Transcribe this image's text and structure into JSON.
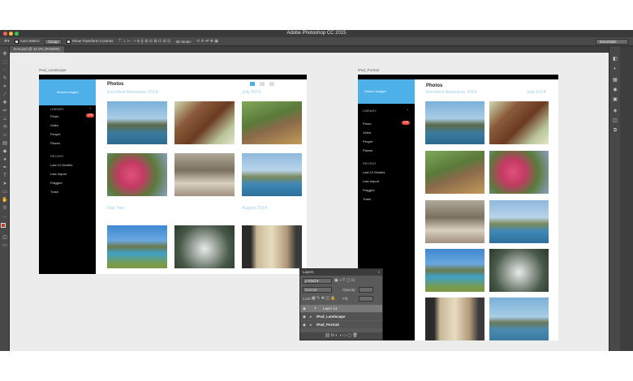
{
  "window": {
    "title": "Adobe Photoshop CC 2015"
  },
  "options_bar": {
    "auto_select_label": "Auto-Select:",
    "auto_select_value": "Group",
    "show_transform_label": "Show Transform Controls",
    "mode_3d": "3D Mode:",
    "workspace": "Essentials"
  },
  "document_tab": {
    "label": "EAV.psd @ 42.3% (RGB/8#)"
  },
  "artboards": {
    "landscape": {
      "label": "iPad_Landscape",
      "search": "Search images",
      "library": "LIBRARY",
      "nav": [
        "Photo",
        "Video",
        "People",
        "Places"
      ],
      "badge": "176",
      "recent": "RECENT",
      "recent_items": [
        "Last 12 Months",
        "Last Import",
        "Flagged",
        "Trash"
      ],
      "title": "Photos",
      "section1": "Excellent Adventure 2014",
      "section1_date": "July 2014",
      "section2": "Day Two",
      "section2_date": "August 2014"
    },
    "portrait": {
      "label": "iPad_Portrait",
      "search": "Search images",
      "library": "LIBRARY",
      "nav": [
        "Photo",
        "Video",
        "People",
        "Places"
      ],
      "badge": "176",
      "recent": "RECENT",
      "recent_items": [
        "Last 12 Months",
        "Last Import",
        "Flagged",
        "Trash"
      ],
      "title": "Photos",
      "section1": "Excellent Adventure 2014",
      "section1_date": "July 2014"
    }
  },
  "layers_panel": {
    "title": "Layers",
    "filter": "Kind",
    "blend": "Normal",
    "opacity_label": "Opacity:",
    "lock_label": "Lock:",
    "fill_label": "Fill:",
    "layers": [
      "Layer 14",
      "iPad_Landscape",
      "iPad_Portrait"
    ]
  }
}
